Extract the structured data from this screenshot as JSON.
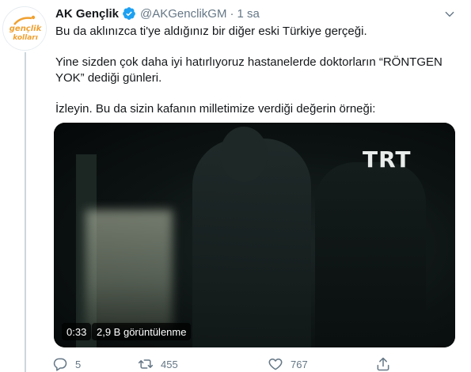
{
  "author": {
    "name": "AK Gençlik",
    "handle": "@AKGenclikGM",
    "separator": "·",
    "time": "1 sa",
    "avatar_text_top": "gençlik",
    "avatar_text_bottom": "kolları"
  },
  "tweet": {
    "paragraphs": [
      "Bu da aklınızca ti'ye aldığınız bir diğer eski Türkiye gerçeği.",
      "Yine sizden çok daha iyi hatırlıyoruz hastanelerde doktorların “RÖNTGEN YOK” dediği günleri.",
      "İzleyin. Bu da sizin kafanın milletimize verdiği değerin örneği:"
    ]
  },
  "video": {
    "watermark": "TRT",
    "duration": "0:33",
    "views": "2,9 B görüntülenme"
  },
  "actions": {
    "replies": "5",
    "retweets": "455",
    "likes": "767"
  },
  "icons": {
    "verified": "verified-badge-icon",
    "caret": "chevron-down-icon",
    "reply": "reply-icon",
    "retweet": "retweet-icon",
    "like": "heart-icon",
    "share": "share-icon"
  },
  "colors": {
    "verified": "#1da1f2",
    "secondary_text": "#657786",
    "primary_text": "#14171a",
    "thread_line": "#ccd6dd"
  }
}
